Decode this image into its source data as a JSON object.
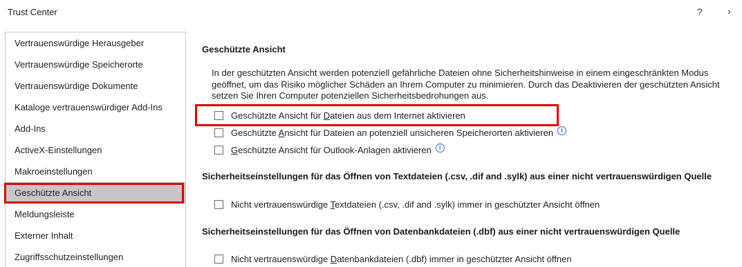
{
  "window": {
    "title": "Trust Center",
    "help_label": "?",
    "close_label": "›"
  },
  "sidebar": {
    "items": [
      {
        "label": "Vertrauenswürdige Herausgeber"
      },
      {
        "label": "Vertrauenswürdige Speicherorte"
      },
      {
        "label": "Vertrauenswürdige Dokumente"
      },
      {
        "label": "Kataloge vertrauenswürdiger Add-Ins"
      },
      {
        "label": "Add-Ins"
      },
      {
        "label": "ActiveX-Einstellungen"
      },
      {
        "label": "Makroeinstellungen"
      },
      {
        "label": "Geschützte Ansicht"
      },
      {
        "label": "Meldungsleiste"
      },
      {
        "label": "Externer Inhalt"
      },
      {
        "label": "Zugriffsschutzeinstellungen"
      }
    ],
    "selected": "Geschützte Ansicht"
  },
  "main": {
    "section1": {
      "heading": "Geschützte Ansicht",
      "description": "In der geschützten Ansicht werden potenziell gefährliche Dateien ohne Sicherheitshinweise in einem eingeschränkten Modus geöffnet, um das Risiko möglicher Schäden an Ihrem Computer zu minimieren. Durch das Deaktivieren der geschützten Ansicht setzen Sie Ihren Computer potenziellen Sicherheitsbedrohungen aus.",
      "options": [
        {
          "pre": "Geschützte Ansicht für ",
          "acc": "D",
          "post": "ateien aus dem Internet aktivieren",
          "checked": false,
          "info": false
        },
        {
          "pre": "Geschützte ",
          "acc": "A",
          "post": "nsicht für Dateien an potenziell unsicheren Speicherorten aktivieren",
          "checked": false,
          "info": true
        },
        {
          "pre": "",
          "acc": "G",
          "post": "eschützte Ansicht für Outlook-Anlagen aktivieren",
          "checked": false,
          "info": true
        }
      ],
      "info_icon": "info-icon"
    },
    "section2": {
      "heading": "Sicherheitseinstellungen für das Öffnen von Textdateien (.csv, .dif and .sylk) aus einer nicht vertrauenswürdigen Quelle",
      "option": {
        "pre": "Nicht vertrauenswürdige ",
        "acc": "T",
        "post": "extdateien (.csv, .dif and .sylk) immer in geschützter Ansicht öffnen",
        "checked": false
      }
    },
    "section3": {
      "heading": "Sicherheitseinstellungen für das Öffnen von Datenbankdateien (.dbf) aus einer nicht vertrauenswürdigen Quelle",
      "option": {
        "pre": "Nicht vertrauenswürdige ",
        "acc": "D",
        "post": "atenbankdateien (.dbf) immer in geschützter Ansicht öffnen",
        "checked": false
      }
    }
  },
  "colors": {
    "highlight_border": "#e00000",
    "selected_bg": "#c7c7c7",
    "info_blue": "#2b6cd6"
  }
}
